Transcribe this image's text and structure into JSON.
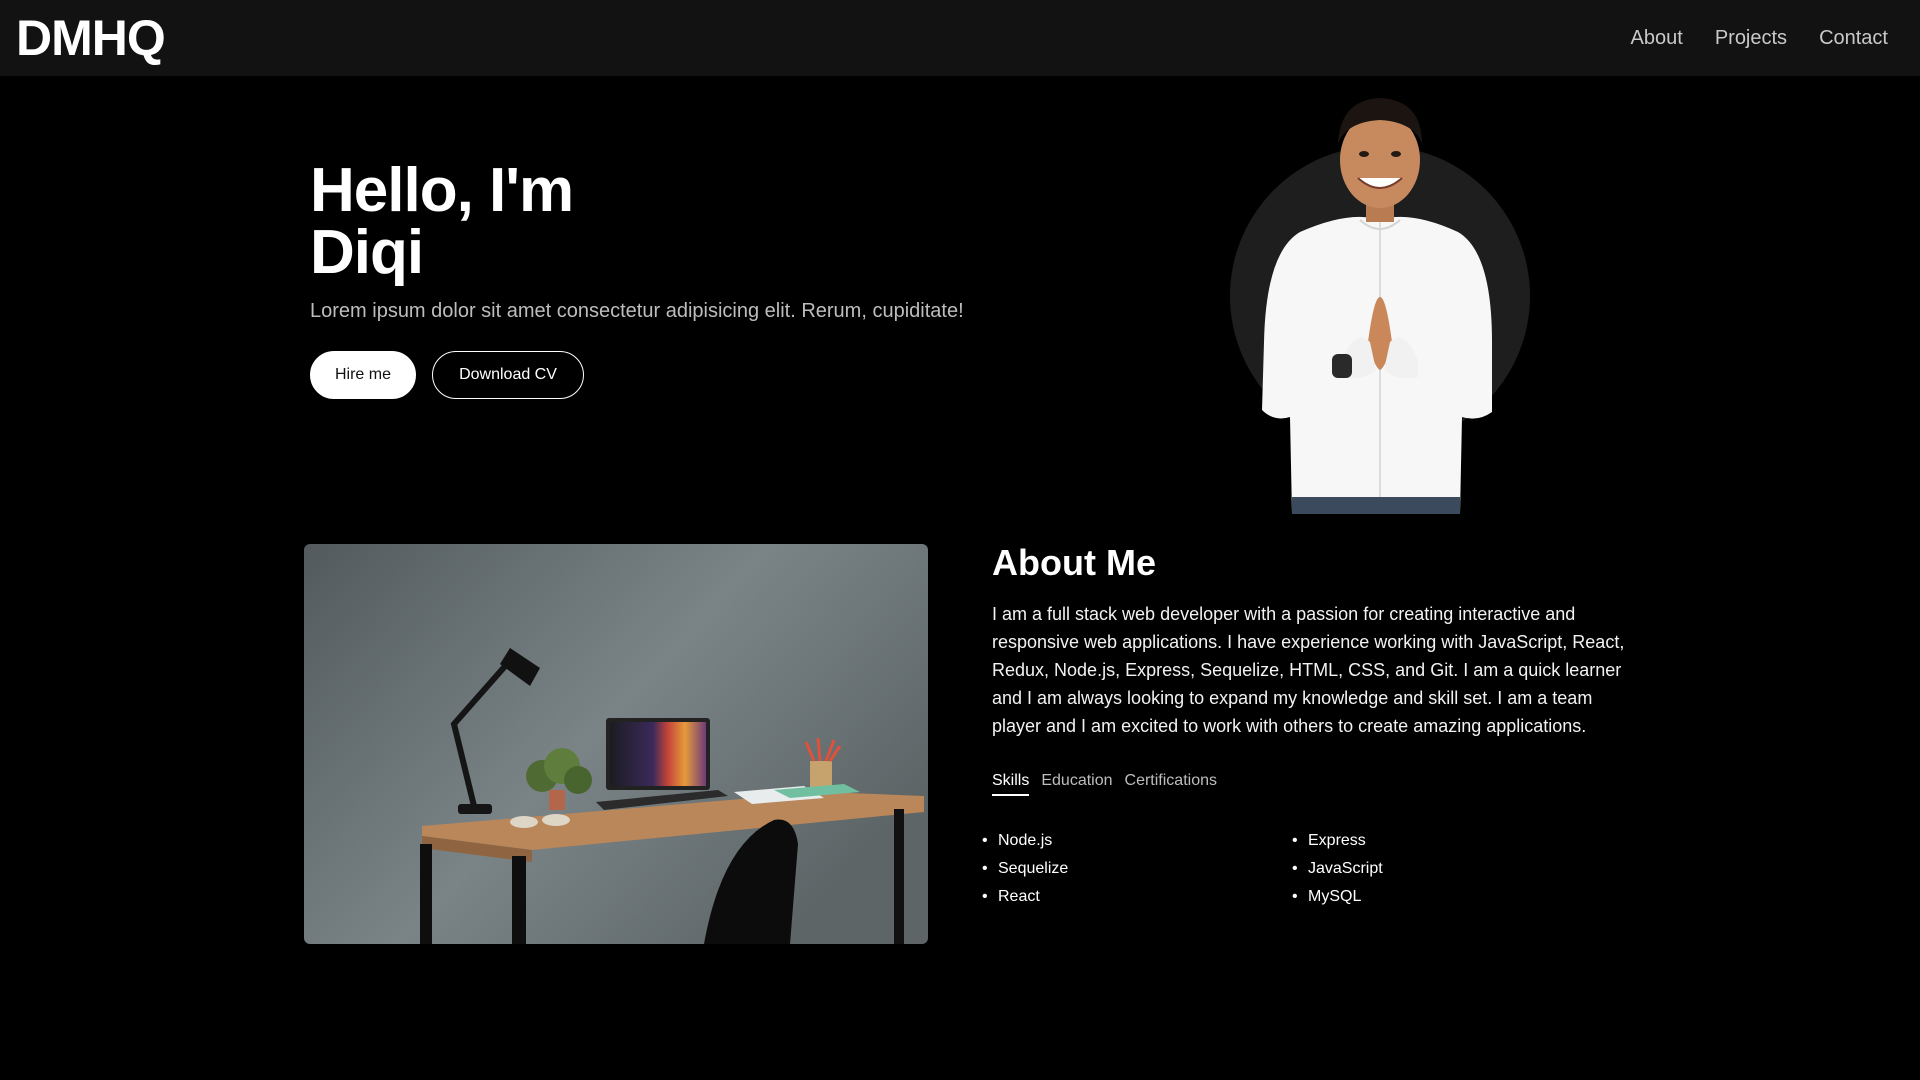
{
  "navbar": {
    "logo": "DMHQ",
    "links": [
      "About",
      "Projects",
      "Contact"
    ]
  },
  "hero": {
    "title_line1": "Hello, I'm",
    "title_line2": "Diqi",
    "tagline": "Lorem ipsum dolor sit amet consectetur adipisicing elit. Rerum, cupiditate!",
    "primary_button": "Hire me",
    "secondary_button": "Download CV"
  },
  "about": {
    "title": "About Me",
    "text": "I am a full stack web developer with a passion for creating interactive and responsive web applications. I have experience working with JavaScript, React, Redux, Node.js, Express, Sequelize, HTML, CSS, and Git. I am a quick learner and I am always looking to expand my knowledge and skill set. I am a team player and I am excited to work with others to create amazing applications.",
    "tabs": [
      "Skills",
      "Education",
      "Certifications"
    ],
    "active_tab": "Skills",
    "skills": [
      "Node.js",
      "Express",
      "Sequelize",
      "JavaScript",
      "React",
      "MySQL"
    ]
  },
  "colors": {
    "background": "#000000",
    "navbar": "#121212",
    "accent": "#1f6feb"
  }
}
